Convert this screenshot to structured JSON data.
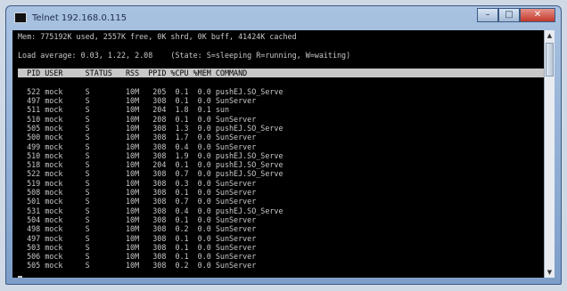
{
  "window": {
    "title": "Telnet 192.168.0.115",
    "minimize_glyph": "–",
    "maximize_glyph": "□",
    "close_glyph": "✕"
  },
  "console": {
    "lines": [
      "Mem: 775192K used, 2557K free, 0K shrd, 0K buff, 41424K cached",
      "Load average: 0.03, 1.22, 2.08    (State: S=sleeping R=running, W=waiting)"
    ],
    "header": "  PID USER     STATUS   RSS  PPID %CPU %MEM COMMAND",
    "rows": [
      "  522 mock     S        10M   205  0.1  0.0 pushEJ.SO_Serve",
      "  497 mock     S        10M   308  0.1  0.0 SunServer",
      "  511 mock     S        10M   204  1.8  0.1 sun",
      "  510 mock     S        10M   208  0.1  0.0 SunServer",
      "  505 mock     S        10M   308  1.3  0.0 pushEJ.SO_Serve",
      "  500 mock     S        10M   308  1.7  0.0 SunServer",
      "  499 mock     S        10M   308  0.4  0.0 SunServer",
      "  510 mock     S        10M   308  1.9  0.0 pushEJ.SO_Serve",
      "  518 mock     S        10M   204  0.1  0.0 pushEJ.SO_Serve",
      "  522 mock     S        10M   308  0.7  0.0 pushEJ.SO_Serve",
      "  519 mock     S        10M   308  0.3  0.0 SunServer",
      "  508 mock     S        10M   308  0.1  0.0 SunServer",
      "  501 mock     S        10M   308  0.7  0.0 SunServer",
      "  531 mock     S        10M   308  0.4  0.0 pushEJ.SO_Serve",
      "  504 mock     S        10M   308  0.1  0.0 SunServer",
      "  498 mock     S        10M   308  0.2  0.0 SunServer",
      "  497 mock     S        10M   308  0.1  0.0 SunServer",
      "  503 mock     S        10M   308  0.1  0.0 SunServer",
      "  506 mock     S        10M   308  0.1  0.0 SunServer",
      "  505 mock     S        10M   308  0.2  0.0 SunServer"
    ]
  }
}
